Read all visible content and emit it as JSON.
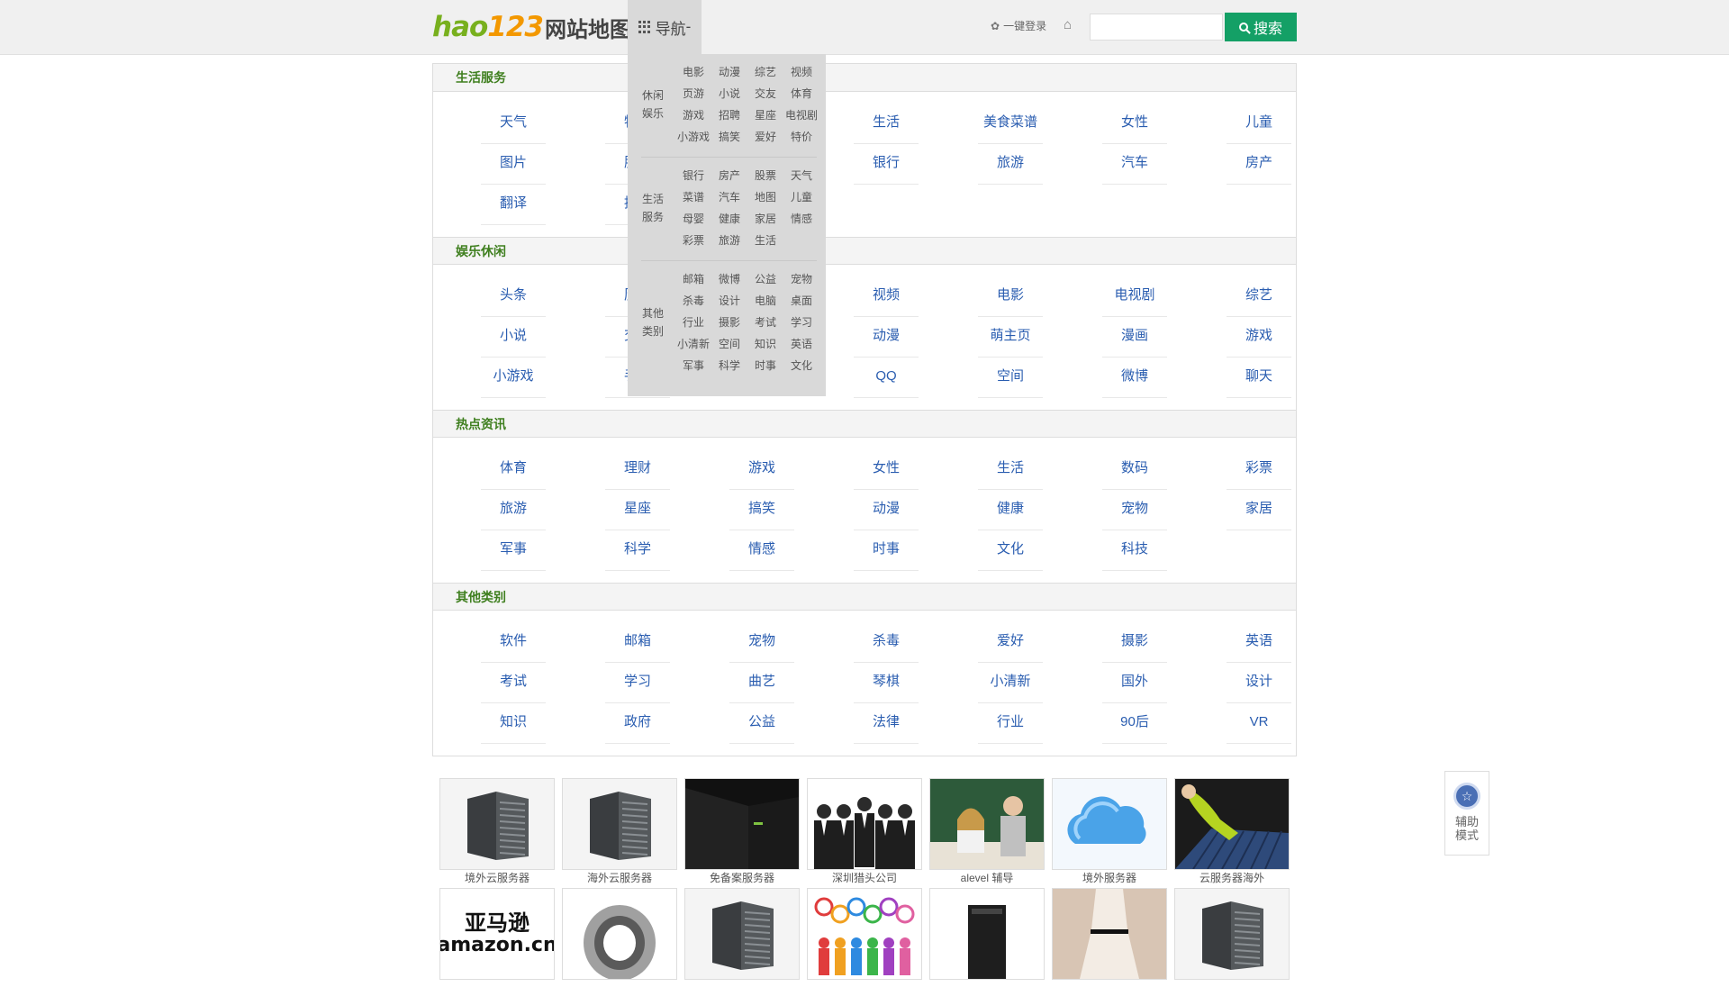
{
  "header": {
    "logo_brand_a": "hao",
    "logo_brand_b": "123",
    "logo_title": "网站地图",
    "nav_label": "导航",
    "nav_caret": "-",
    "login_label": "一键登录",
    "search_placeholder": "",
    "search_button": "搜索"
  },
  "sections": [
    {
      "title": "生活服务",
      "links": [
        "天气",
        "特价",
        "",
        "生活",
        "美食菜谱",
        "女性",
        "儿童",
        "图片",
        "股票",
        "",
        "银行",
        "旅游",
        "汽车",
        "房产",
        "翻译",
        "招聘",
        "",
        "",
        "",
        "",
        ""
      ]
    },
    {
      "title": "娱乐休闲",
      "links": [
        "头条",
        "历史",
        "",
        "视频",
        "电影",
        "电视剧",
        "综艺",
        "小说",
        "交友",
        "",
        "动漫",
        "萌主页",
        "漫画",
        "游戏",
        "小游戏",
        "手游",
        "",
        "QQ",
        "空间",
        "微博",
        "聊天"
      ]
    },
    {
      "title": "热点资讯",
      "links": [
        "体育",
        "理财",
        "游戏",
        "女性",
        "生活",
        "数码",
        "彩票",
        "旅游",
        "星座",
        "搞笑",
        "动漫",
        "健康",
        "宠物",
        "家居",
        "军事",
        "科学",
        "情感",
        "时事",
        "文化",
        "科技",
        ""
      ]
    },
    {
      "title": "其他类别",
      "links": [
        "软件",
        "邮箱",
        "宠物",
        "杀毒",
        "爱好",
        "摄影",
        "英语",
        "考试",
        "学习",
        "曲艺",
        "琴棋",
        "小清新",
        "国外",
        "设计",
        "知识",
        "政府",
        "公益",
        "法律",
        "行业",
        "90后",
        "VR"
      ]
    }
  ],
  "dropdown": [
    {
      "label": "休闲娱乐",
      "items": [
        "电影",
        "动漫",
        "综艺",
        "视频",
        "页游",
        "小说",
        "交友",
        "体育",
        "游戏",
        "招聘",
        "星座",
        "电视剧",
        "小游戏",
        "搞笑",
        "爱好",
        "特价"
      ]
    },
    {
      "label": "生活服务",
      "items": [
        "银行",
        "房产",
        "股票",
        "天气",
        "菜谱",
        "汽车",
        "地图",
        "儿童",
        "母婴",
        "健康",
        "家居",
        "情感",
        "彩票",
        "旅游",
        "生活"
      ]
    },
    {
      "label": "其他类别",
      "items": [
        "邮箱",
        "微博",
        "公益",
        "宠物",
        "杀毒",
        "设计",
        "电脑",
        "桌面",
        "行业",
        "摄影",
        "考试",
        "学习",
        "小清新",
        "空间",
        "知识",
        "英语",
        "军事",
        "科学",
        "时事",
        "文化"
      ]
    }
  ],
  "thumbnails": [
    {
      "caption": "境外云服务器",
      "icon": "server-rack-image"
    },
    {
      "caption": "海外云服务器",
      "icon": "server-rack-image"
    },
    {
      "caption": "免备案服务器",
      "icon": "datacenter-image"
    },
    {
      "caption": "深圳猎头公司",
      "icon": "business-people-image"
    },
    {
      "caption": "alevel 辅导",
      "icon": "classroom-image"
    },
    {
      "caption": "境外服务器",
      "icon": "cloud-image"
    },
    {
      "caption": "云服务器海外",
      "icon": "keyboard-vacuum-image"
    }
  ],
  "thumbnails_row2": [
    {
      "caption": "",
      "icon": "amazon-logo-image",
      "logo_a": "亚马逊",
      "logo_b": "amazon.cn"
    },
    {
      "caption": "",
      "icon": "bearing-image"
    },
    {
      "caption": "",
      "icon": "server-rack-image"
    },
    {
      "caption": "",
      "icon": "people-speech-image"
    },
    {
      "caption": "",
      "icon": "tower-server-image"
    },
    {
      "caption": "",
      "icon": "dress-image"
    },
    {
      "caption": "",
      "icon": "server-rack-image"
    }
  ],
  "assist": {
    "label": "辅助模式"
  },
  "colors": {
    "accent": "#14a066",
    "section_title": "#3f7f1f",
    "link": "#2a5db0"
  }
}
